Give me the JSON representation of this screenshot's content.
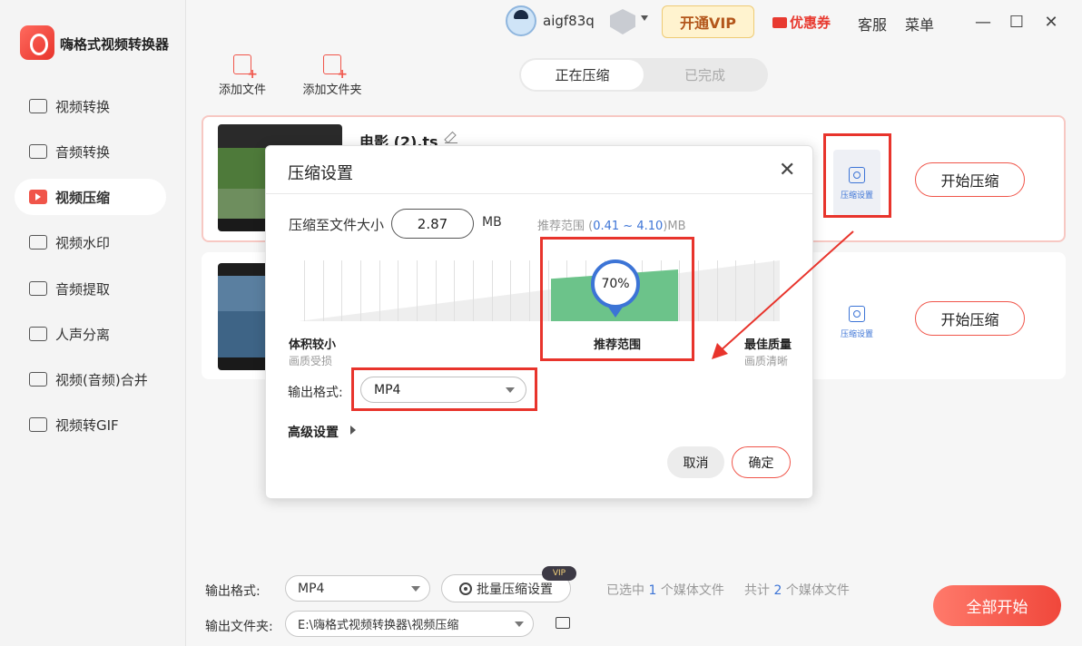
{
  "app": {
    "title": "嗨格式视频转换器"
  },
  "sidebar": {
    "items": [
      {
        "label": "视频转换",
        "icon": "video-convert-icon"
      },
      {
        "label": "音频转换",
        "icon": "audio-convert-icon"
      },
      {
        "label": "视频压缩",
        "icon": "video-compress-icon",
        "active": true
      },
      {
        "label": "视频水印",
        "icon": "watermark-icon"
      },
      {
        "label": "音频提取",
        "icon": "audio-extract-icon"
      },
      {
        "label": "人声分离",
        "icon": "voice-separate-icon"
      },
      {
        "label": "视频(音频)合并",
        "icon": "merge-icon"
      },
      {
        "label": "视频转GIF",
        "icon": "gif-icon"
      }
    ]
  },
  "topbar": {
    "username": "aigf83q",
    "vip_label": "开通VIP",
    "coupon_label": "优惠券",
    "service_label": "客服",
    "menu_label": "菜单",
    "minimize": "—",
    "maximize": "☐",
    "close": "✕"
  },
  "toolbar": {
    "add_file": "添加文件",
    "add_folder": "添加文件夹"
  },
  "tabs": [
    {
      "label": "正在压缩",
      "active": true
    },
    {
      "label": "已完成",
      "active": false
    }
  ],
  "files": [
    {
      "name": "电影 (2).ts",
      "settings_label": "压缩设置",
      "start_label": "开始压缩"
    },
    {
      "name": "",
      "settings_label": "压缩设置",
      "start_label": "开始压缩"
    }
  ],
  "dialog": {
    "title": "压缩设置",
    "close": "✕",
    "size_label": "压缩至文件大小",
    "size_value": "2.87",
    "size_unit": "MB",
    "range_prefix": "推荐范围 (",
    "range_min": "0.41",
    "range_sep": " ~ ",
    "range_max": "4.10",
    "range_suffix": ")MB",
    "quality_percent": "70%",
    "left_label": "体积较小",
    "left_sub": "画质受损",
    "middle_label": "推荐范围",
    "right_label": "最佳质量",
    "right_sub": "画质清晰",
    "format_label": "输出格式:",
    "format_value": "MP4",
    "advanced_label": "高级设置",
    "cancel_label": "取消",
    "ok_label": "确定"
  },
  "bottom": {
    "format_label": "输出格式:",
    "format_value": "MP4",
    "batch_label": "批量压缩设置",
    "vip_tag": "VIP",
    "selected_prefix": "已选中 ",
    "selected_count": "1",
    "selected_suffix": " 个媒体文件",
    "total_prefix": "共计 ",
    "total_count": "2",
    "total_suffix": " 个媒体文件",
    "folder_label": "输出文件夹:",
    "folder_value": "E:\\嗨格式视频转换器\\视频压缩",
    "start_all_label": "全部开始"
  },
  "colors": {
    "accent": "#f0554a",
    "highlight_box": "#e8342c",
    "link_blue": "#3c74d6",
    "recommend_green": "#6cc38a"
  }
}
